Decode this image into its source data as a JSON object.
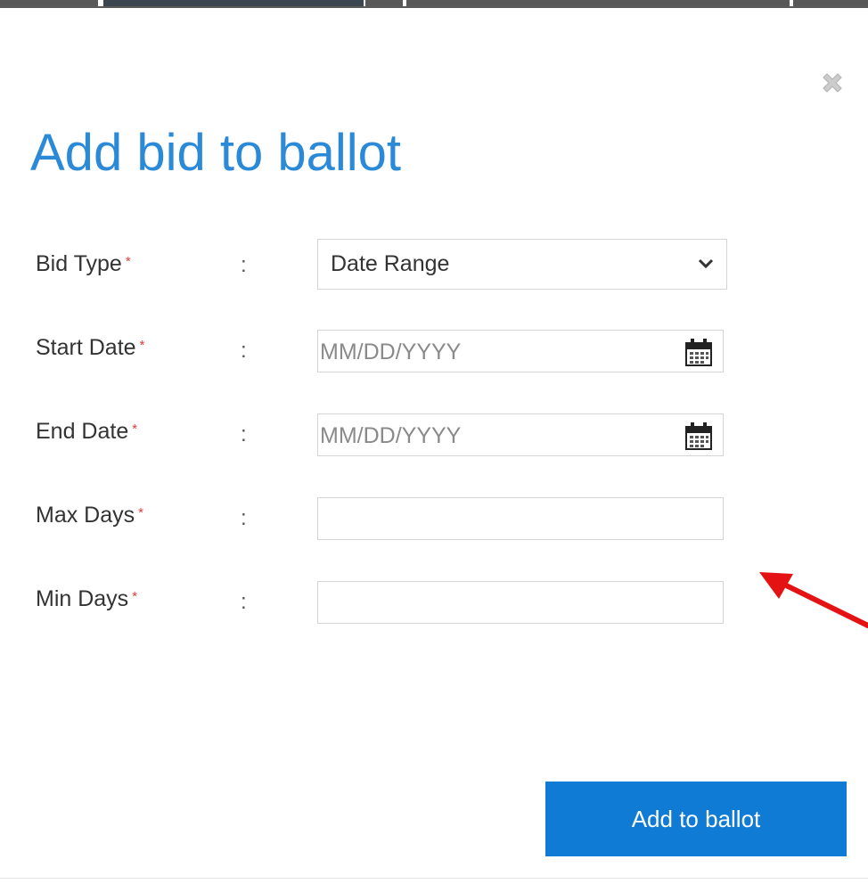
{
  "dialog": {
    "title": "Add bid to ballot",
    "close_icon": "close-icon",
    "fields": [
      {
        "label": "Bid Type",
        "required_mark": "*",
        "separator": ":",
        "type": "select",
        "value": "Date Range",
        "icon": "chevron-down-icon"
      },
      {
        "label": "Start Date",
        "required_mark": "*",
        "separator": ":",
        "type": "date",
        "placeholder": "MM/DD/YYYY",
        "icon": "calendar-icon"
      },
      {
        "label": "End Date",
        "required_mark": "*",
        "separator": ":",
        "type": "date",
        "placeholder": "MM/DD/YYYY",
        "icon": "calendar-icon"
      },
      {
        "label": "Max Days",
        "required_mark": "*",
        "separator": ":",
        "type": "text",
        "value": ""
      },
      {
        "label": "Min Days",
        "required_mark": "*",
        "separator": ":",
        "type": "text",
        "value": ""
      }
    ],
    "submit_label": "Add to ballot"
  },
  "colors": {
    "title": "#2a8ad8",
    "required": "#e23a3a",
    "primary_button": "#0f7bd4",
    "annotation_arrow": "#e41212"
  }
}
